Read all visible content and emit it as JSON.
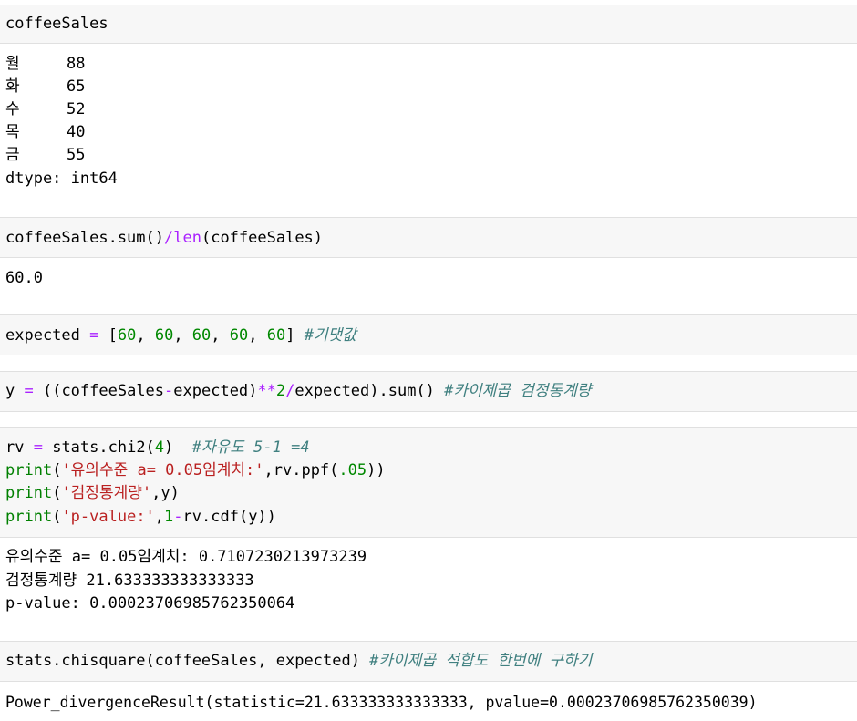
{
  "cells": [
    {
      "input": "coffeeSales",
      "output_series": [
        {
          "label": "월",
          "value": "88"
        },
        {
          "label": "화",
          "value": "65"
        },
        {
          "label": "수",
          "value": "52"
        },
        {
          "label": "목",
          "value": "40"
        },
        {
          "label": "금",
          "value": "55"
        }
      ],
      "output_dtype": "dtype: int64"
    },
    {
      "input_a": "coffeeSales.sum()",
      "input_op": "/",
      "input_fn": "len",
      "input_b": "(coffeeSales)",
      "output": "60.0"
    },
    {
      "input_var": "expected ",
      "input_eq": "=",
      "input_open": " [",
      "nums": [
        "60",
        "60",
        "60",
        "60",
        "60"
      ],
      "input_close": "] ",
      "comment": "#기댓값"
    },
    {
      "y": "y ",
      "eq": "=",
      "p1": " ((coffeeSales",
      "minus": "-",
      "p2": "expected)",
      "pow": "**",
      "two": "2",
      "div": "/",
      "p3": "expected).sum() ",
      "comment": "#카이제곱 검정통계량"
    },
    {
      "l1_a": "rv ",
      "l1_eq": "=",
      "l1_b": " stats.chi2(",
      "l1_num": "4",
      "l1_c": ")  ",
      "l1_comment": "#자유도 5-1 =4",
      "l2_fn": "print",
      "l2_str": "'유의수준 a= 0.05임계치:'",
      "l2_b": ",rv.ppf(",
      "l2_num": ".05",
      "l2_c": "))",
      "l3_fn": "print",
      "l3_str": "'검정통계량'",
      "l3_b": ",y)",
      "l4_fn": "print",
      "l4_str": "'p-value:'",
      "l4_b": ",",
      "l4_num": "1",
      "l4_minus": "-",
      "l4_c": "rv.cdf(y))",
      "out1": "유의수준 a= 0.05임계치: 0.7107230213973239",
      "out2": "검정통계량 21.633333333333333",
      "out3": "p-value: 0.00023706985762350064"
    },
    {
      "input": "stats.chisquare(coffeeSales, expected) ",
      "comment": "#카이제곱 적합도 한번에 구하기",
      "output": "Power_divergenceResult(statistic=21.633333333333333, pvalue=0.00023706985762350039)"
    }
  ]
}
